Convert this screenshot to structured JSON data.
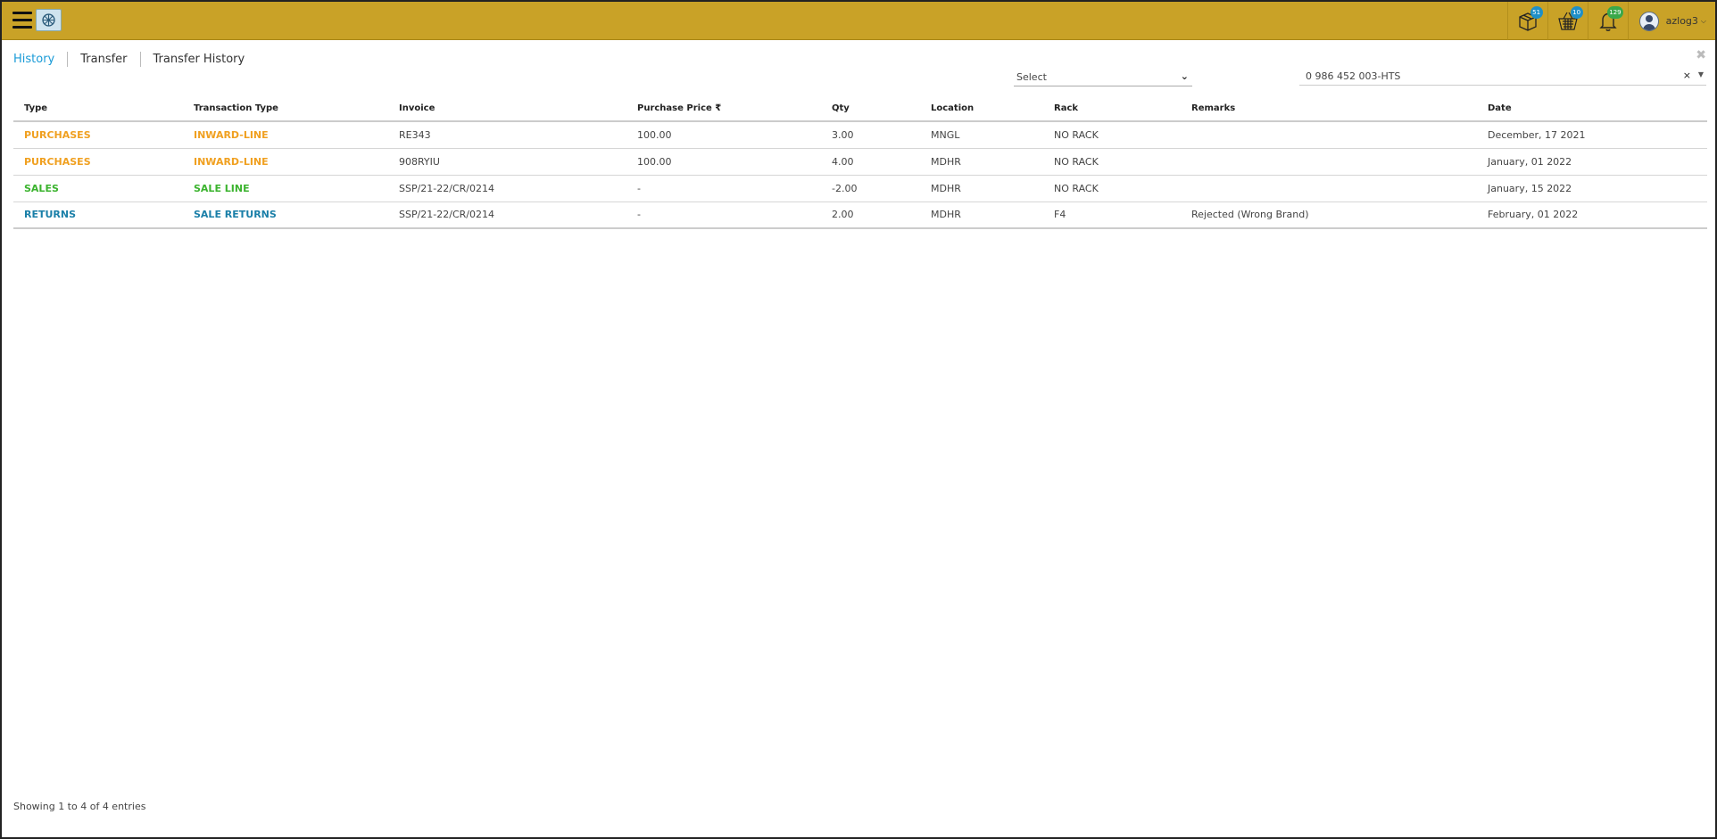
{
  "topbar": {
    "icons": [
      {
        "name": "package-icon",
        "badge": "51",
        "badge_color": "#1e8fc8"
      },
      {
        "name": "basket-icon",
        "badge": "10",
        "badge_color": "#1e8fc8"
      },
      {
        "name": "bell-icon",
        "badge": "129",
        "badge_color": "#3aa84a"
      }
    ],
    "username": "azlog3",
    "bar_color": "#c9a227"
  },
  "tabs": [
    "History",
    "Transfer",
    "Transfer History"
  ],
  "filters": {
    "select_value": "Select",
    "item_value": "0 986 452 003-HTS",
    "clear_symbol": "×"
  },
  "table": {
    "headers": [
      "Type",
      "Transaction Type",
      "Invoice",
      "Purchase Price ₹",
      "Qty",
      "Location",
      "Rack",
      "Remarks",
      "Date"
    ],
    "rows": [
      {
        "type": "PURCHASES",
        "ttype": "INWARD-LINE",
        "invoice": "RE343",
        "price": "100.00",
        "qty": "3.00",
        "location": "MNGL",
        "rack": "NO RACK",
        "remarks": "",
        "date": "December, 17 2021",
        "color": "#f0a020"
      },
      {
        "type": "PURCHASES",
        "ttype": "INWARD-LINE",
        "invoice": "908RYIU",
        "price": "100.00",
        "qty": "4.00",
        "location": "MDHR",
        "rack": "NO RACK",
        "remarks": "",
        "date": "January, 01 2022",
        "color": "#f0a020"
      },
      {
        "type": "SALES",
        "ttype": "SALE LINE",
        "invoice": "SSP/21-22/CR/0214",
        "price": "-",
        "qty": "-2.00",
        "location": "MDHR",
        "rack": "NO RACK",
        "remarks": "",
        "date": "January, 15 2022",
        "color": "#3bb32e"
      },
      {
        "type": "RETURNS",
        "ttype": "SALE RETURNS",
        "invoice": "SSP/21-22/CR/0214",
        "price": "-",
        "qty": "2.00",
        "location": "MDHR",
        "rack": "F4",
        "remarks": "Rejected (Wrong Brand)",
        "date": "February, 01 2022",
        "color": "#1a7fa8"
      }
    ]
  },
  "footer": {
    "entries_text": "Showing 1 to 4 of 4 entries"
  }
}
